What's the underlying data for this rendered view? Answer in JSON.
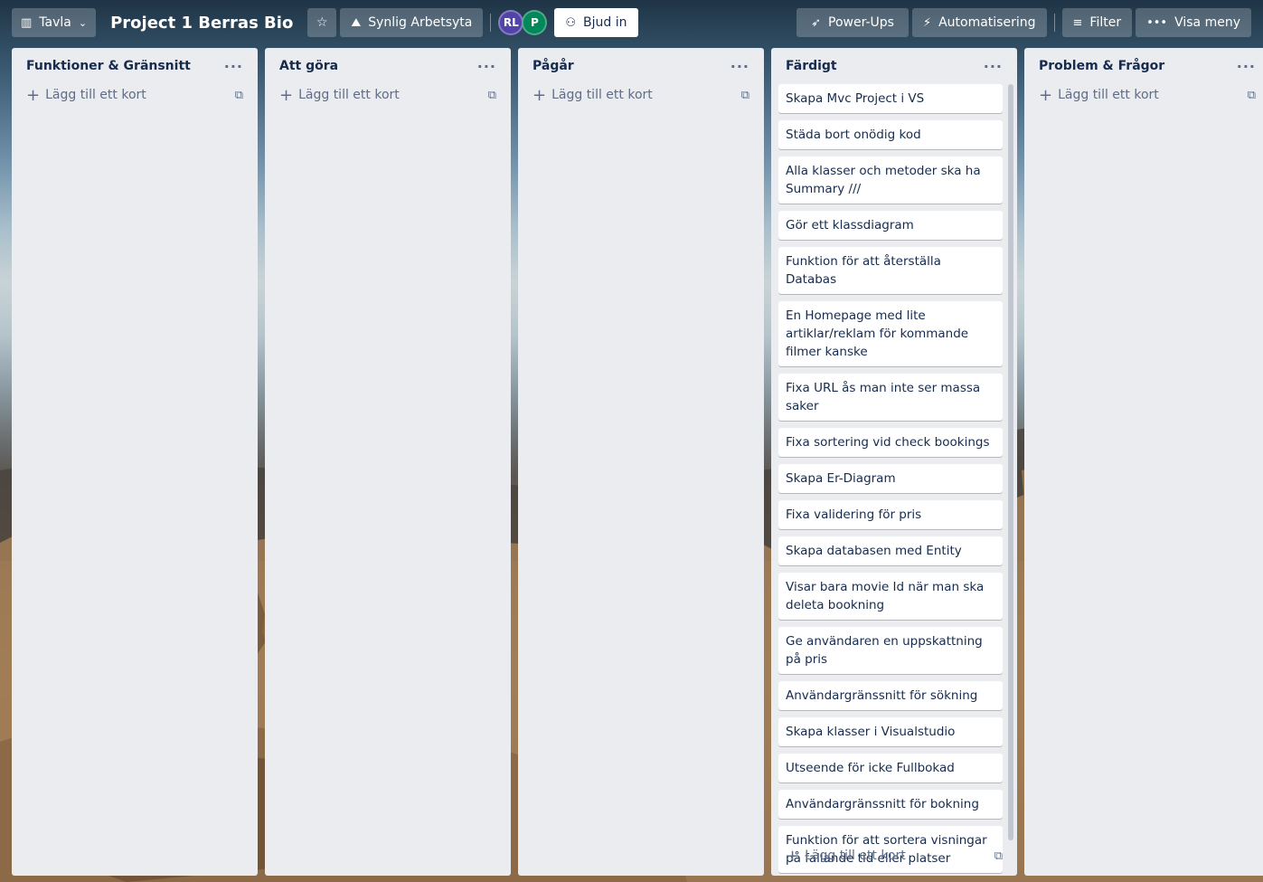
{
  "topbar": {
    "view_label": "Tavla",
    "board_title": "Project 1 Berras Bio",
    "workspace_label": "Synlig Arbetsyta",
    "members": [
      {
        "initials": "RL",
        "color": "#5243aa"
      },
      {
        "initials": "P",
        "color": "#00875a"
      }
    ],
    "invite_label": "Bjud in",
    "powerups_label": "Power-Ups",
    "automation_label": "Automatisering",
    "filter_label": "Filter",
    "menu_label": "Visa meny"
  },
  "add_card_label": "Lägg till ett kort",
  "lists": [
    {
      "title": "Funktioner & Gränsnitt",
      "cards": []
    },
    {
      "title": "Att göra",
      "cards": []
    },
    {
      "title": "Pågår",
      "cards": []
    },
    {
      "title": "Färdigt",
      "cards": [
        "Skapa Mvc Project i VS",
        "Städa bort onödig kod",
        "Alla klasser och metoder ska ha Summary ///",
        "Gör ett klassdiagram",
        "Funktion för att återställa Databas",
        "En Homepage med lite artiklar/reklam för kommande filmer kanske",
        "Fixa URL ås man inte ser massa saker",
        "Fixa sortering vid check bookings",
        "Skapa Er-Diagram",
        "Fixa validering för pris",
        "Skapa databasen med Entity",
        "Visar bara movie Id när man ska deleta bookning",
        "Ge användaren en uppskattning på pris",
        "Användargränssnitt för sökning",
        "Skapa klasser i Visualstudio",
        "Utseende för icke Fullbokad",
        "Användargränssnitt för bokning",
        "Funktion för att sortera visningar på fallande tid eller platser"
      ]
    },
    {
      "title": "Problem & Frågor",
      "cards": []
    }
  ]
}
